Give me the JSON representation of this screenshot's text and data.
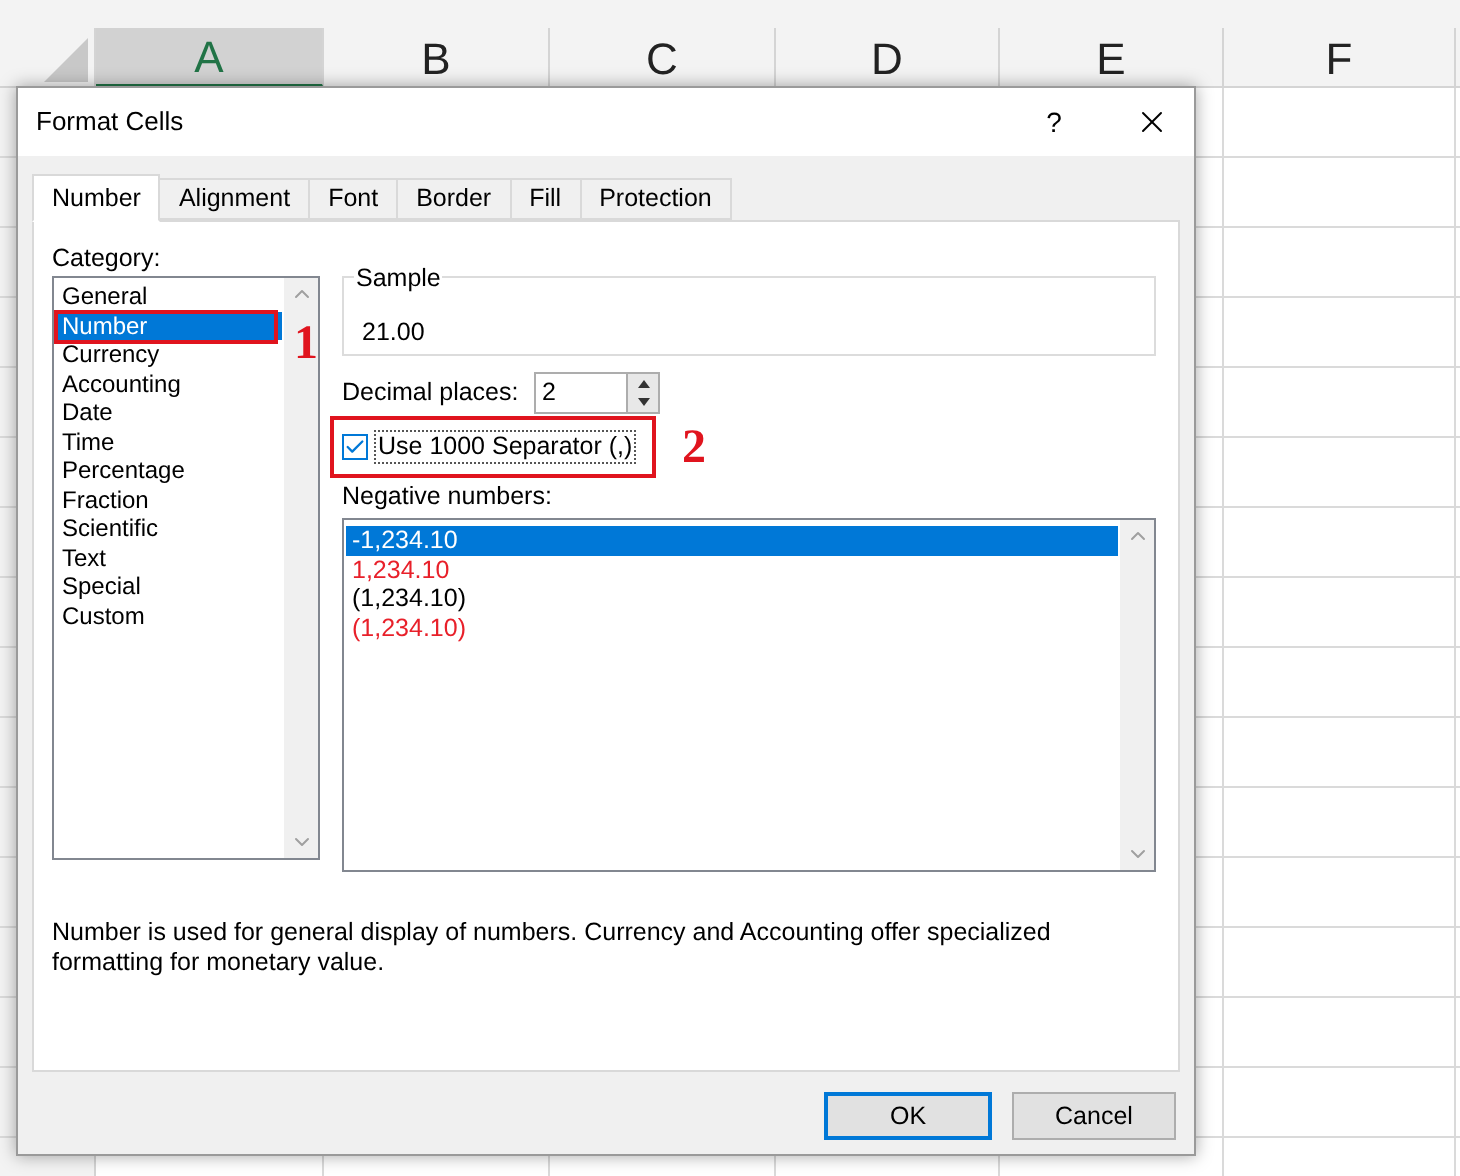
{
  "spreadsheet": {
    "columns": [
      {
        "label": "A",
        "selected": true
      },
      {
        "label": "B",
        "selected": false
      },
      {
        "label": "C",
        "selected": false
      },
      {
        "label": "D",
        "selected": false
      },
      {
        "label": "E",
        "selected": false
      },
      {
        "label": "F",
        "selected": false
      }
    ]
  },
  "dialog": {
    "title": "Format Cells",
    "help_button": "?",
    "tabs": [
      {
        "label": "Number",
        "selected": true
      },
      {
        "label": "Alignment",
        "selected": false
      },
      {
        "label": "Font",
        "selected": false
      },
      {
        "label": "Border",
        "selected": false
      },
      {
        "label": "Fill",
        "selected": false
      },
      {
        "label": "Protection",
        "selected": false
      }
    ],
    "category": {
      "label": "Category:",
      "items": [
        {
          "label": "General",
          "selected": false
        },
        {
          "label": "Number",
          "selected": true
        },
        {
          "label": "Currency",
          "selected": false
        },
        {
          "label": "Accounting",
          "selected": false
        },
        {
          "label": "Date",
          "selected": false
        },
        {
          "label": "Time",
          "selected": false
        },
        {
          "label": "Percentage",
          "selected": false
        },
        {
          "label": "Fraction",
          "selected": false
        },
        {
          "label": "Scientific",
          "selected": false
        },
        {
          "label": "Text",
          "selected": false
        },
        {
          "label": "Special",
          "selected": false
        },
        {
          "label": "Custom",
          "selected": false
        }
      ]
    },
    "sample": {
      "label": "Sample",
      "value": "21.00"
    },
    "decimal_places": {
      "label": "Decimal places:",
      "value": "2"
    },
    "separator": {
      "label": "Use 1000 Separator (,)",
      "checked": true
    },
    "negative_numbers": {
      "label": "Negative numbers:",
      "items": [
        {
          "label": "-1,234.10",
          "selected": true
        },
        {
          "label": "1,234.10",
          "color": "#e8202a",
          "selected": false
        },
        {
          "label": "(1,234.10)",
          "color": "#000000",
          "selected": false
        },
        {
          "label": "(1,234.10)",
          "color": "#e8202a",
          "selected": false
        }
      ]
    },
    "description": "Number is used for general display of numbers.  Currency and Accounting offer specialized formatting for monetary value.",
    "buttons": [
      {
        "label": "OK",
        "default": true
      },
      {
        "label": "Cancel",
        "default": false
      }
    ]
  },
  "annotations": [
    {
      "label": "1"
    },
    {
      "label": "2"
    }
  ]
}
